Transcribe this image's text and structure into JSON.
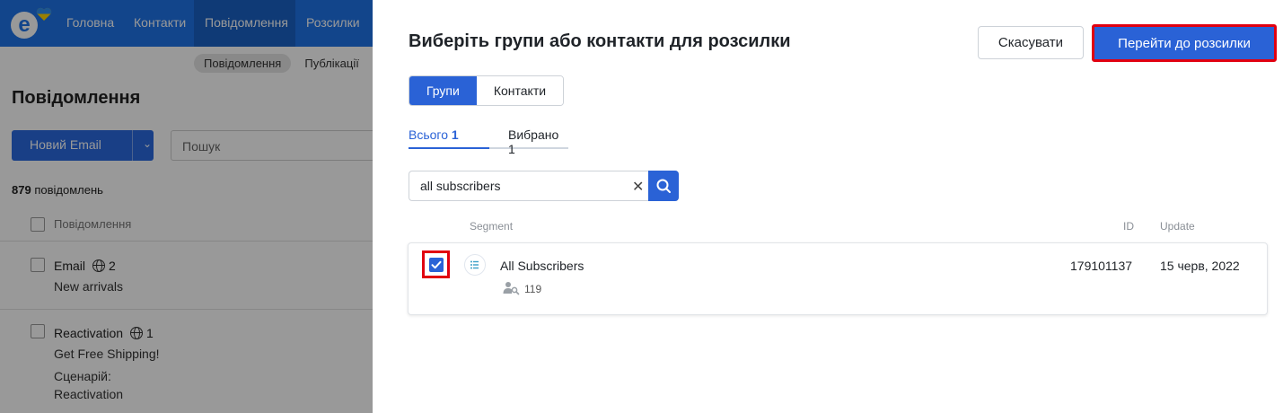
{
  "app": {
    "nav": [
      "Головна",
      "Контакти",
      "Повідомлення",
      "Розсилки"
    ],
    "nav_active": "Повідомлення",
    "sub_tabs": [
      "Повідомлення",
      "Публікації"
    ],
    "page_title": "Повідомлення",
    "new_email_label": "Новий Email",
    "search_placeholder": "Пошук",
    "count_number": "879",
    "count_label": "повідомлень",
    "list_header": "Повідомлення",
    "messages": [
      {
        "title": "Email",
        "langs": "2",
        "subject": "New arrivals"
      },
      {
        "title": "Reactivation",
        "langs": "1",
        "subject": "Get Free Shipping!",
        "scenario_label": "Сценарій:",
        "scenario": "Reactivation"
      }
    ]
  },
  "panel": {
    "title": "Виберіть групи або контакти для розсилки",
    "cancel_label": "Скасувати",
    "go_label": "Перейти до розсилки",
    "toggle": [
      "Групи",
      "Контакти"
    ],
    "toggle_active": "Групи",
    "tabs": [
      {
        "label": "Всього",
        "count": "1"
      },
      {
        "label": "Вибрано",
        "count": "1"
      }
    ],
    "search_value": "all subscribers",
    "columns": {
      "segment": "Segment",
      "id": "ID",
      "update": "Update"
    },
    "rows": [
      {
        "name": "All Subscribers",
        "contacts": "119",
        "id": "179101137",
        "update": "15 черв, 2022",
        "checked": true
      }
    ]
  },
  "colors": {
    "primary": "#2a62d6",
    "nav_bg": "#1e73e8",
    "highlight": "#e10010"
  }
}
